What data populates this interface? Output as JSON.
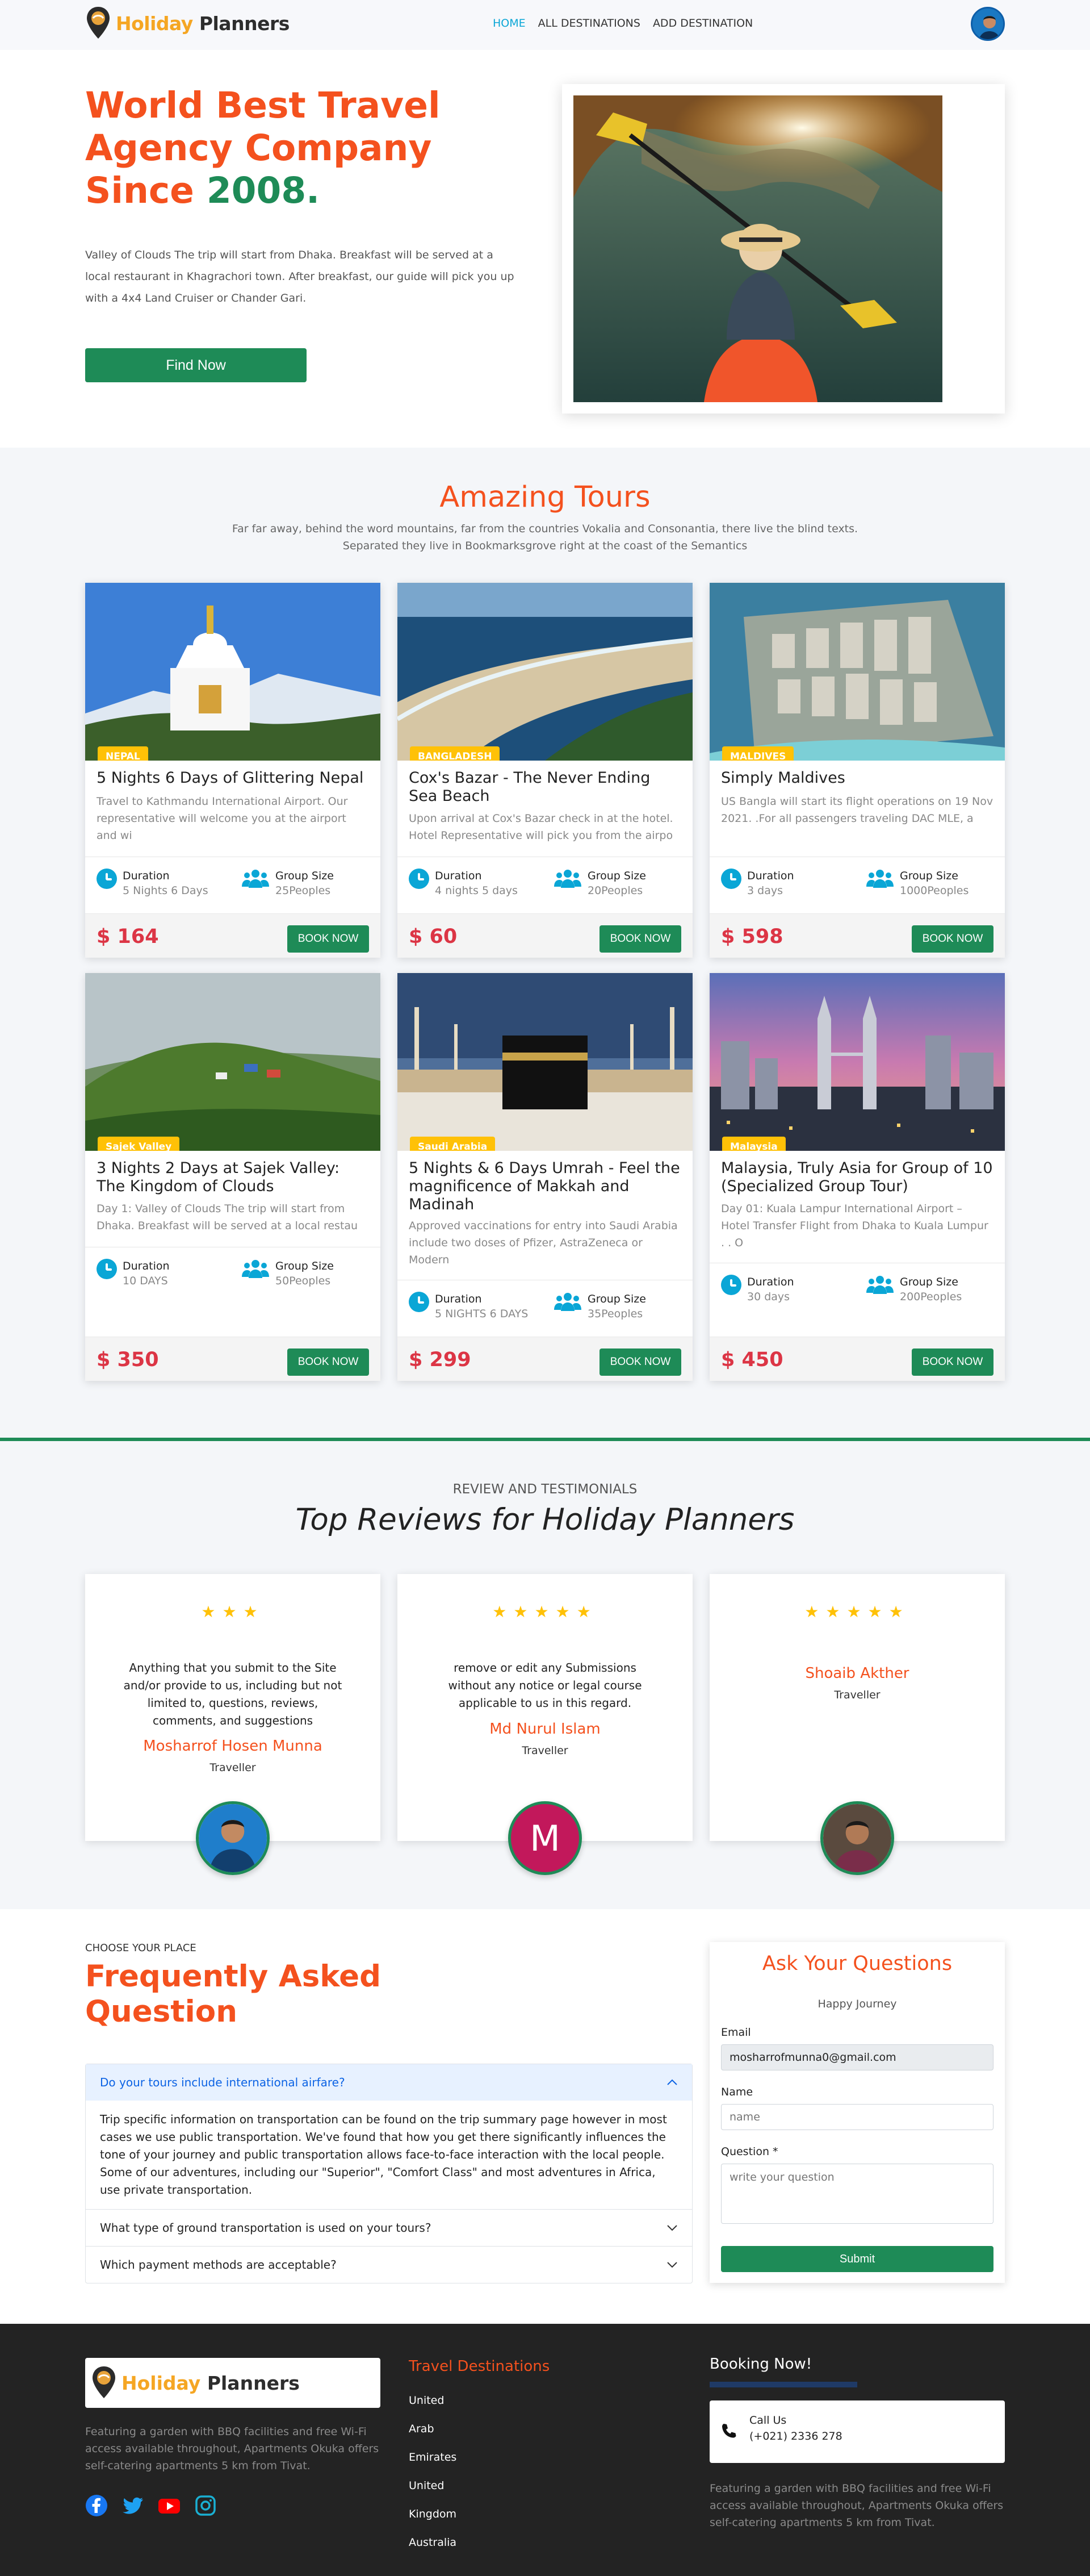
{
  "nav": {
    "logo_word1": "Holiday",
    "logo_word2": "Planners",
    "links": [
      "HOME",
      "ALL DESTINATIONS",
      "ADD DESTINATION"
    ]
  },
  "hero": {
    "title": "World Best Travel Agency Company Since",
    "year": "2008.",
    "text": "Valley of Clouds The trip will start from Dhaka. Breakfast will be served at a local restaurant in Khagrachori town. After breakfast, our guide will pick you up with a 4x4 Land Cruiser or Chander Gari.",
    "button": "Find Now"
  },
  "tours": {
    "title": "Amazing Tours",
    "subtitle": "Far far away, behind the word mountains, far from the countries Vokalia and Consonantia, there live the blind texts. Separated they live in Bookmarksgrove right at the coast of the Semantics",
    "duration_label": "Duration",
    "group_label": "Group Size",
    "book_label": "BOOK NOW",
    "items": [
      {
        "badge": "NEPAL",
        "title": "5 Nights 6 Days of Glittering Nepal",
        "desc": "Travel to Kathmandu International Airport. Our representative will welcome you at the airport and wi",
        "duration": "5 Nights 6 Days",
        "group": "25Peoples",
        "price": "$ 164"
      },
      {
        "badge": "BANGLADESH",
        "title": "Cox's Bazar - The Never Ending Sea Beach",
        "desc": "Upon arrival at Cox's Bazar check in at the hotel. Hotel Representative will pick you from the airpo",
        "duration": "4 nights 5 days",
        "group": "20Peoples",
        "price": "$ 60"
      },
      {
        "badge": "MALDIVES",
        "title": "Simply Maldives",
        "desc": "US Bangla will start its flight operations on 19 Nov 2021. .For all passengers traveling DAC MLE, a",
        "duration": "3 days",
        "group": "1000Peoples",
        "price": "$ 598"
      },
      {
        "badge": "Sajek Valley",
        "title": "3 Nights 2 Days at Sajek Valley: The Kingdom of Clouds",
        "desc": "Day 1: Valley of Clouds The trip will start from Dhaka. Breakfast will be served at a local restau",
        "duration": "10 DAYS",
        "group": "50Peoples",
        "price": "$ 350"
      },
      {
        "badge": "Saudi Arabia",
        "title": "5 Nights & 6 Days Umrah - Feel the magnificence of Makkah and Madinah",
        "desc": "Approved vaccinations for entry into Saudi Arabia include two doses of Pfizer, AstraZeneca or Modern",
        "duration": "5 NIGHTS 6 DAYS",
        "group": "35Peoples",
        "price": "$ 299"
      },
      {
        "badge": "Malaysia",
        "title": "Malaysia, Truly Asia for Group of 10 (Specialized Group Tour)",
        "desc": "Day 01: Kuala Lampur International Airport – Hotel Transfer Flight from Dhaka to Kuala Lumpur . . O",
        "duration": "30 days",
        "group": "200Peoples",
        "price": "$ 450"
      }
    ]
  },
  "reviews": {
    "kicker": "REVIEW AND TESTIMONIALS",
    "title": "Top Reviews for Holiday Planners",
    "items": [
      {
        "stars": "★★★",
        "rating": 3,
        "text": "Anything that you submit to the Site and/or provide to us, including but not limited to, questions, reviews, comments, and suggestions",
        "name": "Mosharrof Hosen Munna",
        "role": "Traveller"
      },
      {
        "stars": "★★★★★",
        "rating": 5,
        "text": "remove or edit any Submissions without any notice or legal course applicable to us in this regard.",
        "name": "Md Nurul Islam",
        "role": "Traveller",
        "initial": "M"
      },
      {
        "stars": "★★★★★",
        "rating": 5,
        "text": "",
        "name": "Shoaib Akther",
        "role": "Traveller"
      }
    ]
  },
  "faq": {
    "kicker": "CHOOSE YOUR PLACE",
    "title": "Frequently Asked Question",
    "items": [
      {
        "q": "Do your tours include international airfare?",
        "a": "Trip specific information on transportation can be found on the trip summary page however in most cases we use public transportation. We've found that how you get there significantly influences the tone of your journey and public transportation allows face-to-face interaction with the local people. Some of our adventures, including our \"Superior\", \"Comfort Class\" and most adventures in Africa, use private transportation."
      },
      {
        "q": "What type of ground transportation is used on your tours?"
      },
      {
        "q": "Which payment methods are acceptable?"
      }
    ]
  },
  "ask": {
    "title": "Ask Your Questions",
    "subtitle": "Happy Journey",
    "email_label": "Email",
    "email_value": "mosharrofmunna0@gmail.com",
    "name_label": "Name",
    "name_placeholder": "name",
    "question_label": "Question *",
    "question_placeholder": "write your question",
    "submit": "Submit"
  },
  "footer": {
    "desc": "Featuring a garden with BBQ facilities and free Wi-Fi access available throughout, Apartments Okuka offers self-catering apartments 5 km from Tivat.",
    "dest_title": "Travel Destinations",
    "destinations": [
      "United",
      "Arab",
      "Emirates",
      "United",
      "Kingdom",
      "Australia"
    ],
    "booking_title": "Booking Now!",
    "call_label": "Call Us",
    "phone": "(+021) 2336 278",
    "desc2": "Featuring a garden with BBQ facilities and free Wi-Fi access available throughout, Apartments Okuka offers self-catering apartments 5 km from Tivat."
  },
  "colors": {
    "accent": "#f4511e",
    "green": "#1e8b57",
    "link": "#0aa6d6",
    "badge": "#ffc107",
    "price": "#dc3545"
  }
}
